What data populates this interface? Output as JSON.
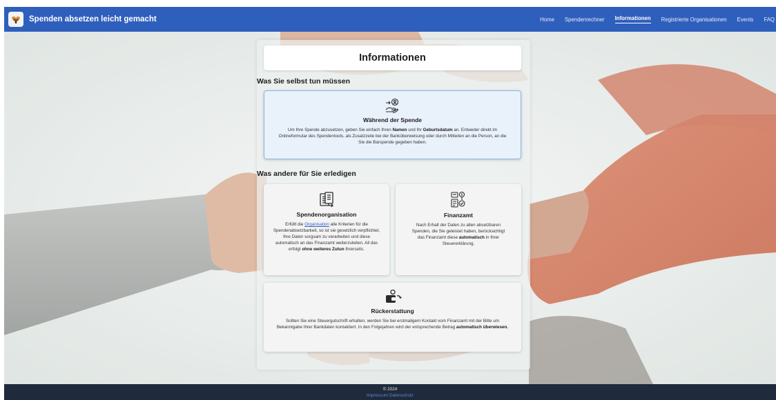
{
  "brand": {
    "title": "Spenden absetzen leicht gemacht",
    "logo_icon": "hand-heart-logo"
  },
  "nav": {
    "items": [
      {
        "label": "Home",
        "active": false
      },
      {
        "label": "Spendenrechner",
        "active": false
      },
      {
        "label": "Informationen",
        "active": true
      },
      {
        "label": "Registrierte Organisationen",
        "active": false
      },
      {
        "label": "Events",
        "active": false
      },
      {
        "label": "FAQ",
        "active": false
      }
    ]
  },
  "page": {
    "title": "Informationen"
  },
  "sections": {
    "self": {
      "heading": "Was Sie selbst tun müssen",
      "card": {
        "icon": "donate-person-icon",
        "title": "Während der Spende",
        "text_1": "Um Ihre Spende abzusetzen, geben Sie einfach Ihren ",
        "bold_1": "Namen",
        "text_2": " und Ihr ",
        "bold_2": "Geburtsdatum",
        "text_3": " an. Entweder direkt im Onlineformular des Spendentools, als Zusatzzeile bei der Banküberweisung oder durch Mitteilen an die Person, an die Sie die Barspende gegeben haben."
      }
    },
    "others": {
      "heading": "Was andere für Sie erledigen",
      "organisation": {
        "icon": "document-transfer-icon",
        "title": "Spendenorganisation",
        "text_1": "Erfüllt die ",
        "link": "Organisation",
        "text_2": " alle Kriterien für die Spendenabsetzbarkeit, so ist sie gesetzlich verpflichtet, Ihre Daten sorgsam zu verarbeiten und diese automatisch an das Finanzamt weiterzuleiten. All das erfolgt ",
        "bold": "ohne weiteres Zutun",
        "text_3": " Ihrerseits."
      },
      "finanzamt": {
        "icon": "tax-office-icon",
        "title": "Finanzamt",
        "text_1": "Nach Erhalt der Daten zu allen absetzbaren Spenden, die Sie geleistet haben, berücksichtigt das Finanzamt diese ",
        "bold": "automatisch",
        "text_2": " in Ihrer Steuererklärung."
      },
      "refund": {
        "icon": "wallet-refund-icon",
        "title": "Rückerstattung",
        "text_1": "Sollten Sie eine Steuergutschrift erhalten, werden Sie bei erstmaligem Kontakt vom Finanzamt mit der Bitte um Bekanntgabe Ihrer Bankdaten kontaktiert. In den Folgejahren wird der entsprechende Betrag ",
        "bold": "automatisch überwiesen."
      }
    }
  },
  "footer": {
    "copyright": "© 2024",
    "impressum": "Impressum",
    "datenschutz": "Datenschutz"
  },
  "colors": {
    "navbar": "#2f5fbd",
    "footer": "#1f2a3c",
    "highlight_card": "#e9f1fb",
    "link": "#2f5fbd"
  }
}
